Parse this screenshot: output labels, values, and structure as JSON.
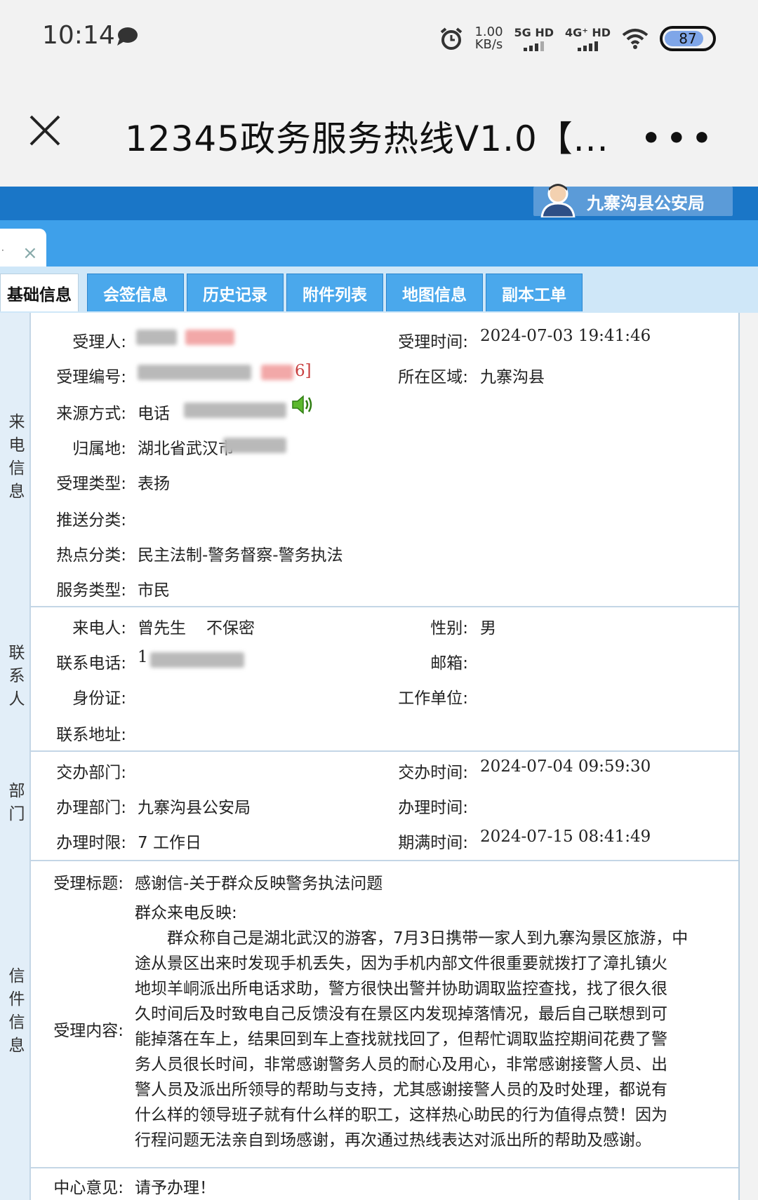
{
  "status_bar": {
    "time": "10:14",
    "speed_value": "1.00",
    "speed_unit": "KB/s",
    "net1": "5G HD",
    "net2": "4G⁺ HD",
    "battery": "87",
    "icons": [
      "chat-bubble-icon",
      "alarm-icon",
      "signal-icon",
      "wifi-icon",
      "battery-icon"
    ]
  },
  "title_bar": {
    "title": "12345政务服务热线V1.0【...",
    "more": "•••"
  },
  "header": {
    "user_name": "九寨沟县公安局",
    "tab_close": "×",
    "tab_dot": "·"
  },
  "subtabs": [
    "基础信息",
    "会签信息",
    "历史记录",
    "附件列表",
    "地图信息",
    "副本工单"
  ],
  "caller_info": {
    "section_title": "来电信息",
    "handler_label": "受理人:",
    "accept_time_label": "受理时间:",
    "accept_time": "2024-07-03 19:41:46",
    "number_label": "受理编号:",
    "number_suffix": "6]",
    "region_label": "所在区域:",
    "region": "九寨沟县",
    "source_label": "来源方式:",
    "source": "电话",
    "location_label": "归属地:",
    "location": "湖北省武汉市",
    "type_label": "受理类型:",
    "type": "表扬",
    "push_label": "推送分类:",
    "hot_label": "热点分类:",
    "hot": "民主法制-警务督察-警务执法",
    "service_label": "服务类型:",
    "service": "市民"
  },
  "contact": {
    "section_title": "联系人",
    "caller_label": "来电人:",
    "caller": "曾先生",
    "privacy": "不保密",
    "gender_label": "性别:",
    "gender": "男",
    "phone_label": "联系电话:",
    "phone_prefix": "1",
    "email_label": "邮箱:",
    "id_label": "身份证:",
    "work_label": "工作单位:",
    "address_label": "联系地址:"
  },
  "department": {
    "section_title": "部门",
    "assign_dept_label": "交办部门:",
    "assign_time_label": "交办时间:",
    "assign_time": "2024-07-04 09:59:30",
    "handle_dept_label": "办理部门:",
    "handle_dept": "九寨沟县公安局",
    "handle_time_label": "办理时间:",
    "limit_label": "办理时限:",
    "limit": "7 工作日",
    "due_label": "期满时间:",
    "due": "2024-07-15 08:41:49"
  },
  "letter": {
    "section_title": "信件信息",
    "title_label": "受理标题:",
    "title": "感谢信-关于群众反映警务执法问题",
    "content_label": "受理内容:",
    "content_lines": [
      "群众来电反映:",
      "　　群众称自己是湖北武汉的游客，7月3日携带一家人到九寨沟景区旅游，中",
      "途从景区出来时发现手机丢失，因为手机内部文件很重要就拨打了漳扎镇火",
      "地坝羊峒派出所电话求助，警方很快出警并协助调取监控查找，找了很久很",
      "久时间后及时致电自己反馈没有在景区内发现掉落情况，最后自己联想到可",
      "能掉落在车上，结果回到车上查找就找回了，但帮忙调取监控期间花费了警",
      "务人员很长时间，非常感谢警务人员的耐心及用心，非常感谢接警人员、出",
      "警人员及派出所领导的帮助与支持，尤其感谢接警人员的及时处理，都说有",
      "什么样的领导班子就有什么样的职工，这样热心助民的行为值得点赞！因为",
      "行程问题无法亲自到场感谢，再次通过热线表达对派出所的帮助及感谢。"
    ],
    "opinion_label": "中心意见:",
    "opinion": "请予办理！"
  }
}
